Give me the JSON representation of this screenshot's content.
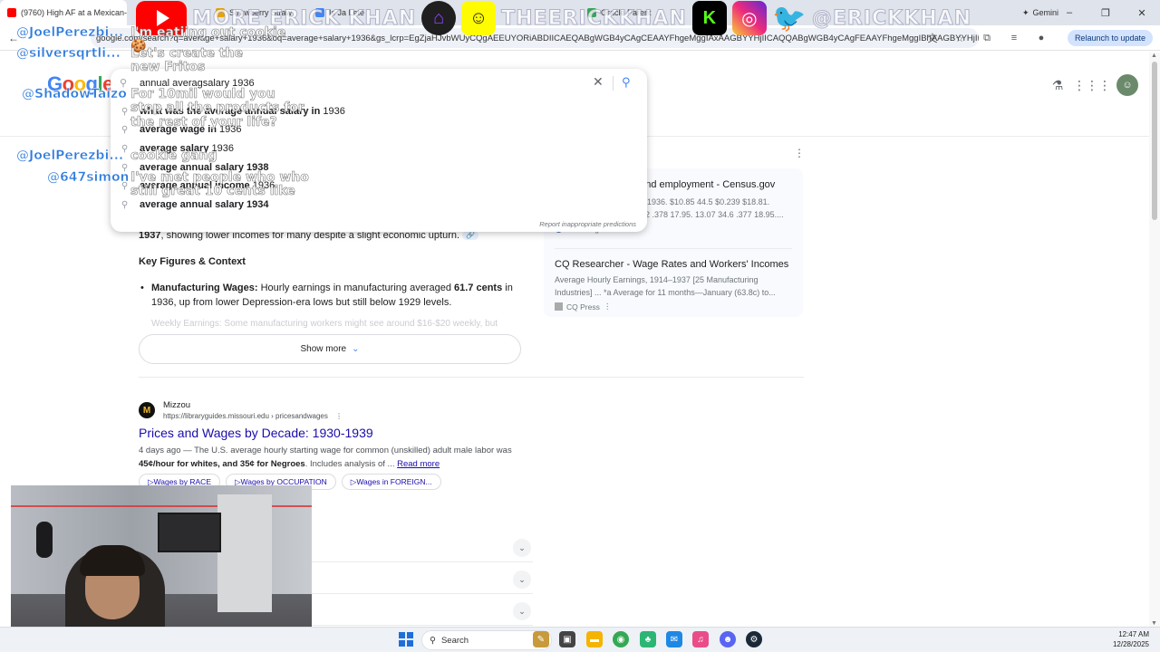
{
  "browser": {
    "tabs": [
      {
        "label": "(9760) High AF at a Mexican-V",
        "color": "#ff0000"
      },
      {
        "label": "Strawberry Straw",
        "color": "#e8a400"
      },
      {
        "label": "Is Ja Lete",
        "color": "#4285f4"
      },
      {
        "label": "Oracle Parent",
        "color": "#34a853"
      },
      {
        "label": "aver",
        "color": "#4285f4"
      },
      {
        "label": "Gemini",
        "color": "#8e44ad"
      }
    ],
    "url": "google.com/search?q=average+salary+1936&oq=average+salary+1936&gs_lcrp=EgZjaHJvbWUyCQgAEEUYORiABDIICAEQABgWGB4yCAgCEAAYFhgeMggIAxAAGBYYHjIICAQQABgWGB4yCAgFEAAYFhgeMggIBhAAGBYYHjIKC...",
    "relaunch_label": "Relaunch to update",
    "window_controls": [
      "–",
      "❐",
      "✕"
    ]
  },
  "overlay": {
    "banner_text_1": "MORE ERICK KHAN",
    "banner_text_2": "THEERICKKHAN",
    "banner_text_3": "@ERICKKHAN",
    "chat": [
      {
        "user": "@JoelPerezbi...",
        "message": "I'm eatiing out cookie🍪"
      },
      {
        "user": "@silversqrtli...",
        "message": "Let's create the new Fritos"
      },
      {
        "user": "@ShadowTaizo",
        "message": "For 10mil would you stop all the products for the rest of your life?"
      },
      {
        "user": "@JoelPerezbi...",
        "message": "cookie gang"
      },
      {
        "user": "@647simon",
        "message": "I've met people who who still great 10 cents like"
      }
    ]
  },
  "google": {
    "logo": [
      "G",
      "o",
      "o",
      "g",
      "l",
      "e"
    ],
    "search_value": "annual averagsalary 1936",
    "suggestions": [
      {
        "bold": "what was the average annual salary in",
        "rest": " 1936"
      },
      {
        "bold": "average wage in",
        "rest": " 1936"
      },
      {
        "bold": "average salary",
        "rest": " 1936"
      },
      {
        "bold": "average annual salary 1938",
        "rest": ""
      },
      {
        "bold": "average annual income",
        "rest": " 1936"
      },
      {
        "bold": "average annual salary 1934",
        "rest": ""
      }
    ],
    "report_label": "Report inappropriate predictions",
    "ai_overview": {
      "line1_bold": "1937",
      "line1_rest": ", showing lower incomes for many despite a slight economic upturn.",
      "heading": "Key Figures & Context",
      "bullet_label": "Manufacturing Wages:",
      "bullet_text_a": " Hourly earnings in manufacturing averaged ",
      "bullet_bold": "61.7 cents",
      "bullet_text_b": " in 1936, up from lower Depression-era lows but still below 1929 levels.",
      "faded_bullet": "Weekly Earnings: Some manufacturing workers might see around $16-$20 weekly, but",
      "show_more": "Show more"
    },
    "sources": [
      {
        "title": ", and employment - Census.gov",
        "snippet_1": "1936. $10.85 44.5 $0.239 $18.81.",
        "snippet_2": "2 .378 17.95. 13.07 34.6 .377 18.95....",
        "source": "Census.gov"
      },
      {
        "title": "CQ Researcher - Wage Rates and Workers' Incomes",
        "snippet_1": "Average Hourly Earnings, 1914–1937 [25 Manufacturing",
        "snippet_2": "Industries] ... *a Average for 11 months—January (63.8c) to...",
        "source": "CQ Press"
      }
    ],
    "result": {
      "site": "Mizzou",
      "url": "https://libraryguides.missouri.edu › pricesandwages",
      "title": "Prices and Wages by Decade: 1930-1939",
      "snippet_a": "4 days ago — The U.S. average hourly starting wage for common (unskilled) adult male labor was ",
      "snippet_bold": "45¢/hour for whites, and 35¢ for Negroes",
      "snippet_b": ". Includes analysis of ... ",
      "read_more": "Read more",
      "chips": [
        "▷Wages by RACE",
        "▷Wages by OCCUPATION",
        "▷Wages in FOREIGN..."
      ]
    }
  },
  "taskbar": {
    "search_label": "Search",
    "time": "12:47 AM",
    "date": "12/28/2025"
  }
}
